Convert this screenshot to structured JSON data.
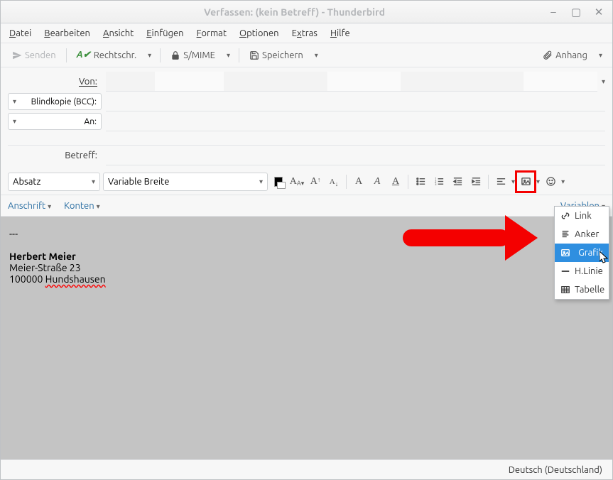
{
  "window": {
    "title": "Verfassen: (kein Betreff) - Thunderbird"
  },
  "menubar": {
    "file": "Datei",
    "edit": "Bearbeiten",
    "view": "Ansicht",
    "insert": "Einfügen",
    "format": "Format",
    "options": "Optionen",
    "extras": "Extras",
    "help": "Hilfe"
  },
  "toolbar": {
    "send": "Senden",
    "spell": "Rechtschr.",
    "smime": "S/MIME",
    "save": "Speichern",
    "attach": "Anhang"
  },
  "headers": {
    "from_label": "Von:",
    "bcc_label": "Blindkopie (BCC):",
    "to_label": "An:",
    "subject_label": "Betreff:"
  },
  "format": {
    "paragraph": "Absatz",
    "font": "Variable Breite"
  },
  "infobar": {
    "address": "Anschrift",
    "accounts": "Konten",
    "variables": "Variablen"
  },
  "insert_menu": {
    "link": "Link",
    "anchor": "Anker",
    "graphic": "Grafik",
    "hline": "H.Linie",
    "table": "Tabelle"
  },
  "body": {
    "sep": "---",
    "name": "Herbert Meier",
    "street": "Meier-Straße 23",
    "zip": "100000",
    "city": "Hundshausen"
  },
  "status": {
    "lang": "Deutsch (Deutschland)"
  }
}
